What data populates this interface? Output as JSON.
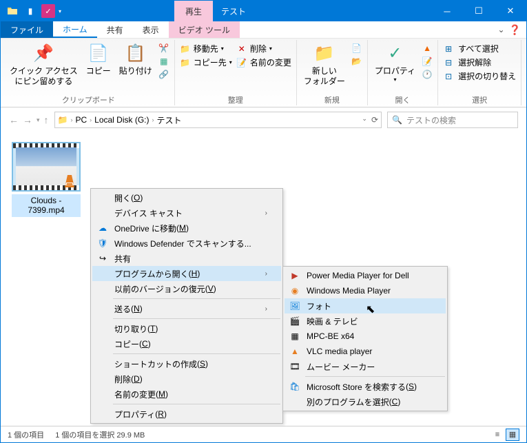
{
  "title": {
    "context_tab": "再生",
    "window": "テスト"
  },
  "tabs": {
    "file": "ファイル",
    "home": "ホーム",
    "share": "共有",
    "view": "表示",
    "video": "ビデオ ツール"
  },
  "ribbon": {
    "pin": {
      "line1": "クイック アクセス",
      "line2": "にピン留めする"
    },
    "copy": "コピー",
    "paste": "貼り付け",
    "clipboard_label": "クリップボード",
    "move_to": "移動先",
    "delete": "削除",
    "copy_to": "コピー先",
    "rename": "名前の変更",
    "organize_label": "整理",
    "new_folder": {
      "line1": "新しい",
      "line2": "フォルダー"
    },
    "new_label": "新規",
    "properties": "プロパティ",
    "open_label": "開く",
    "select_all": "すべて選択",
    "select_none": "選択解除",
    "invert_selection": "選択の切り替え",
    "select_label": "選択"
  },
  "breadcrumbs": {
    "pc": "PC",
    "drive": "Local Disk (G:)",
    "folder": "テスト"
  },
  "search": {
    "placeholder": "テストの検索"
  },
  "file": {
    "name_line1": "Clouds -",
    "name_line2": "7399.mp4"
  },
  "context1": {
    "open": "開く",
    "open_k": "O",
    "cast": "デバイス キャスト",
    "onedrive": "OneDrive に移動",
    "onedrive_k": "M",
    "defender": "Windows Defender でスキャンする...",
    "share": "共有",
    "open_with": "プログラムから開く",
    "open_with_k": "H",
    "restore": "以前のバージョンの復元",
    "restore_k": "V",
    "send_to": "送る",
    "send_to_k": "N",
    "cut": "切り取り",
    "cut_k": "T",
    "copy": "コピー",
    "copy_k": "C",
    "shortcut": "ショートカットの作成",
    "shortcut_k": "S",
    "delete": "削除",
    "delete_k": "D",
    "rename": "名前の変更",
    "rename_k": "M",
    "properties": "プロパティ",
    "properties_k": "R"
  },
  "context2": {
    "pmp": "Power Media Player for Dell",
    "wmp": "Windows Media Player",
    "photo": "フォト",
    "movies_tv": "映画 & テレビ",
    "mpc": "MPC-BE x64",
    "vlc": "VLC media player",
    "movie_maker": "ムービー メーカー",
    "store": "Microsoft Store を検索する",
    "store_k": "S",
    "other": "別のプログラムを選択",
    "other_k": "C"
  },
  "status": {
    "count": "1 個の項目",
    "selected": "1 個の項目を選択 29.9 MB"
  }
}
